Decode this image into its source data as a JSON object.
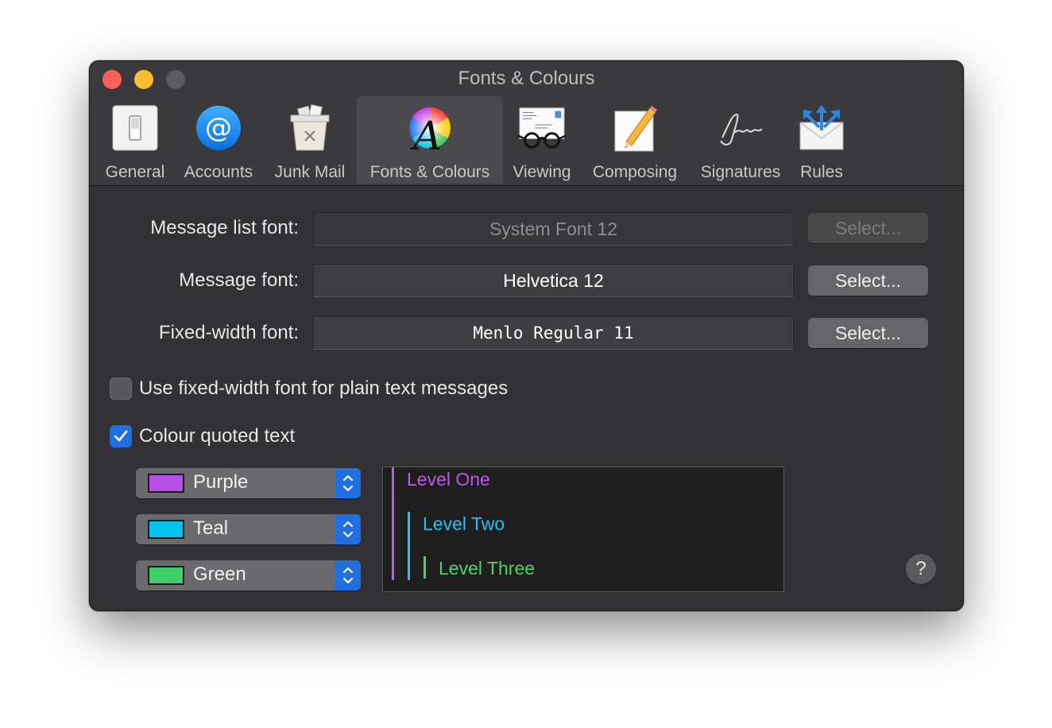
{
  "window": {
    "title": "Fonts & Colours"
  },
  "toolbar": {
    "items": [
      {
        "label": "General",
        "icon": "switch-icon"
      },
      {
        "label": "Accounts",
        "icon": "at-sign-icon"
      },
      {
        "label": "Junk Mail",
        "icon": "junk-bin-icon"
      },
      {
        "label": "Fonts & Colours",
        "icon": "font-colour-wheel-icon",
        "selected": true
      },
      {
        "label": "Viewing",
        "icon": "glasses-letter-icon"
      },
      {
        "label": "Composing",
        "icon": "pencil-paper-icon"
      },
      {
        "label": "Signatures",
        "icon": "signature-icon"
      },
      {
        "label": "Rules",
        "icon": "rules-envelope-icon"
      }
    ]
  },
  "fonts": {
    "message_list": {
      "label": "Message list font:",
      "value": "System Font 12",
      "button": "Select...",
      "enabled": false
    },
    "message": {
      "label": "Message font:",
      "value": "Helvetica 12",
      "button": "Select...",
      "enabled": true
    },
    "fixed_width": {
      "label": "Fixed-width font:",
      "value": "Menlo Regular 11",
      "button": "Select...",
      "enabled": true
    }
  },
  "options": {
    "fixed_width_plain": {
      "label": "Use fixed-width font for plain text messages",
      "checked": false
    },
    "colour_quoted": {
      "label": "Colour quoted text",
      "checked": true
    }
  },
  "quote_colours": [
    {
      "name": "Purple",
      "color": "#b64ee8"
    },
    {
      "name": "Teal",
      "color": "#00c4f0"
    },
    {
      "name": "Green",
      "color": "#3fce67"
    }
  ],
  "preview": {
    "levels": [
      {
        "text": "Level One",
        "color": "#c255ea"
      },
      {
        "text": "Level Two",
        "color": "#1ec2f0"
      },
      {
        "text": "Level Three",
        "color": "#4fd36e"
      }
    ]
  },
  "help": {
    "label": "?"
  },
  "colors": {
    "accent": "#1f6fe0",
    "window_bg": "#323234"
  }
}
